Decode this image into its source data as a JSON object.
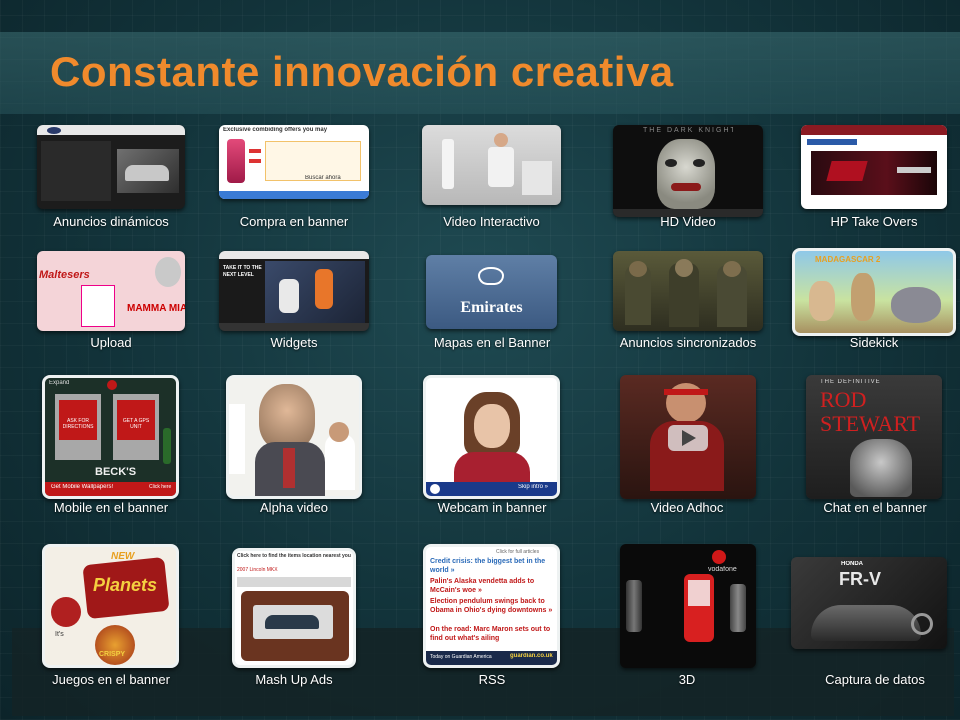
{
  "slide": {
    "title": "Constante innovación creativa",
    "accent_color": "#f08a2c"
  },
  "tiles": [
    {
      "label": "Anuncios dinámicos"
    },
    {
      "label": "Compra en banner",
      "headline": "Exclusive combiding offers you may",
      "button": "Buscar ahora"
    },
    {
      "label": "Video Interactivo"
    },
    {
      "label": "HD Video",
      "heading": "THE DARK KNIGHT"
    },
    {
      "label": "HP Take Overs"
    },
    {
      "label": "Upload",
      "brand": "Maltesers",
      "slogan": "MAMMA MIA!"
    },
    {
      "label": "Widgets",
      "caption": "TAKE IT TO THE NEXT LEVEL"
    },
    {
      "label": "Mapas en el Banner",
      "brand": "Emirates"
    },
    {
      "label": "Anuncios sincronizados"
    },
    {
      "label": "Sidekick",
      "heading": "MADAGASCAR 2"
    },
    {
      "label": "Mobile en el banner",
      "btn1": "ASK FOR DIRECTIONS",
      "btn2": "GET A GPS UNIT",
      "brand": "BECK'S",
      "cta": "Get Mobile Wallpapers!",
      "cta2": "Click here",
      "expand": "Expand"
    },
    {
      "label": "Alpha video"
    },
    {
      "label": "Webcam in banner",
      "cta": "Skip intro »"
    },
    {
      "label": "Video Adhoc"
    },
    {
      "label": "Chat en el banner",
      "kicker": "THE DEFINITIVE",
      "heading1": "ROD",
      "heading2": "STEWART"
    },
    {
      "label": "Juegos en el banner",
      "badge": "NEW",
      "brand": "Planets",
      "tagline": "It's",
      "tagline2": "CRISPY"
    },
    {
      "label": "Mash Up Ads",
      "headline": "Click here to find the items location nearest you",
      "sub": "2007 Lincoln MKX"
    },
    {
      "label": "RSS",
      "header": "Click for full articles",
      "items": [
        "Credit crisis: the biggest bet in the world »",
        "Palin's Alaska vendetta adds to McCain's woe »",
        "Election pendulum swings back to Obama in Ohio's dying downtowns »",
        "On the road: Marc Maron sets out to find out what's ailing"
      ],
      "footer": "Today on Guardian America",
      "site": "guardian.co.uk"
    },
    {
      "label": "3D",
      "brand": "vodafone"
    },
    {
      "label": "Captura de datos",
      "brand": "HONDA",
      "model": "FR-V"
    }
  ]
}
